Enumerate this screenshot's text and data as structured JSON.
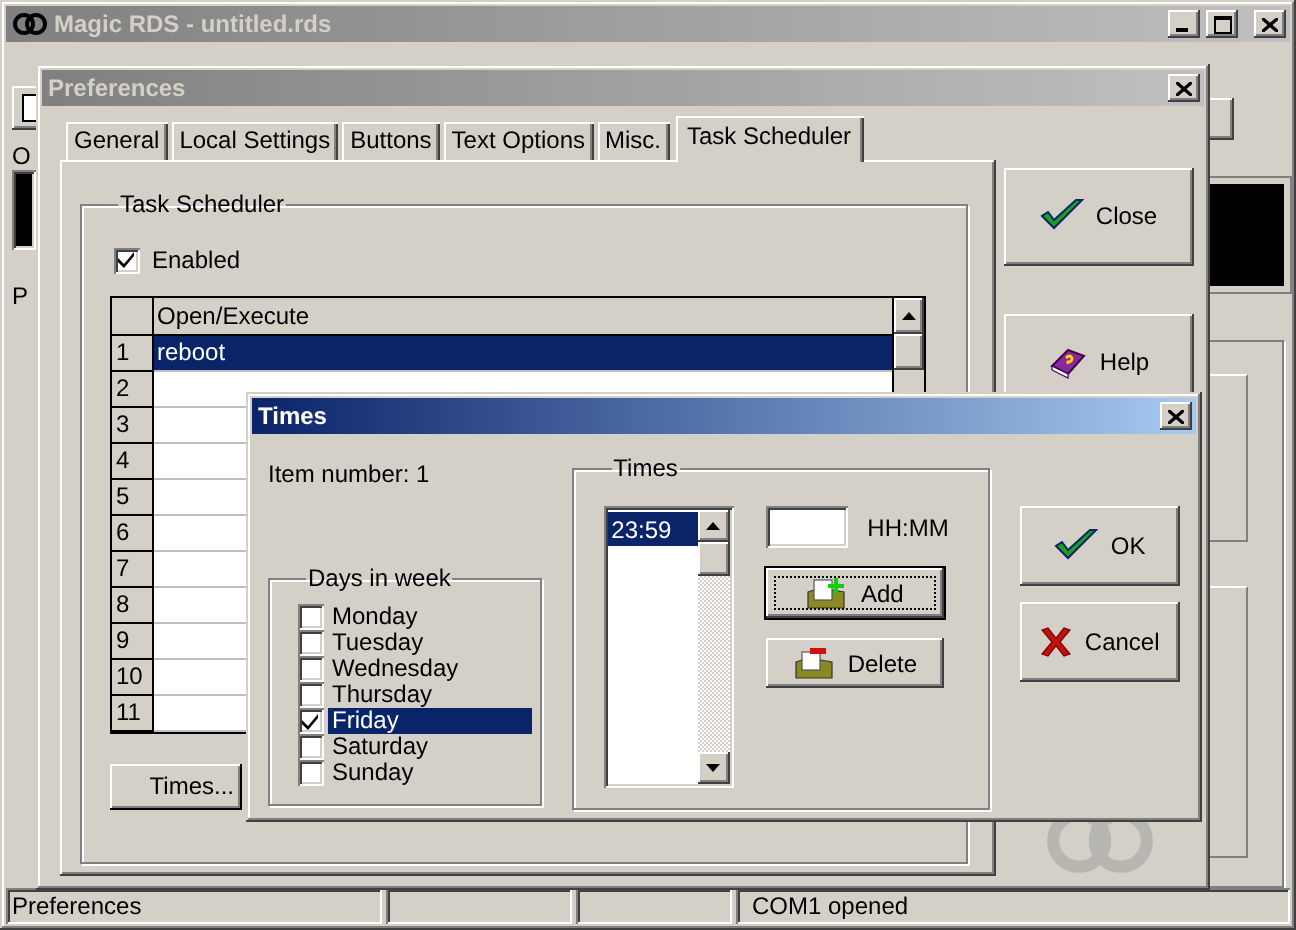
{
  "main_window": {
    "title": "Magic RDS - untitled.rds",
    "active": false,
    "group_labels": [
      "O",
      "P"
    ],
    "status_bar": [
      "Preferences",
      "COM1 opened"
    ]
  },
  "preferences": {
    "title": "Preferences",
    "active": false,
    "tabs": [
      {
        "label": "General",
        "selected": false
      },
      {
        "label": "Local Settings",
        "selected": false
      },
      {
        "label": "Buttons",
        "selected": false
      },
      {
        "label": "Text Options",
        "selected": false
      },
      {
        "label": "Misc.",
        "selected": false
      },
      {
        "label": "Task Scheduler",
        "selected": true
      }
    ],
    "group": "Task Scheduler",
    "enabled": {
      "label": "Enabled",
      "checked": true
    },
    "table": {
      "columns": [
        "Open/Execute"
      ],
      "rows": [
        {
          "number": "1",
          "value": "reboot",
          "selected": true
        },
        {
          "number": "2",
          "selected": false
        },
        {
          "number": "3",
          "selected": false
        },
        {
          "number": "4",
          "selected": false
        },
        {
          "number": "5",
          "selected": false
        },
        {
          "number": "6",
          "selected": false
        },
        {
          "number": "7",
          "selected": false
        },
        {
          "number": "8",
          "selected": false
        },
        {
          "number": "9",
          "selected": false
        },
        {
          "number": "10",
          "selected": false
        },
        {
          "number": "11",
          "selected": false
        }
      ]
    },
    "times_button": "Times...",
    "buttons": [
      {
        "kind": "close",
        "label": "Close"
      },
      {
        "kind": "help",
        "label": "Help"
      }
    ]
  },
  "times_dialog": {
    "title": "Times",
    "active": true,
    "item_number": "Item number: 1",
    "days_group": "Days in week",
    "days": [
      {
        "label": "Monday",
        "checked": false,
        "selected": false
      },
      {
        "label": "Tuesday",
        "checked": false,
        "selected": false
      },
      {
        "label": "Wednesday",
        "checked": false,
        "selected": false
      },
      {
        "label": "Thursday",
        "checked": false,
        "selected": false
      },
      {
        "label": "Friday",
        "checked": true,
        "selected": true
      },
      {
        "label": "Saturday",
        "checked": false,
        "selected": false
      },
      {
        "label": "Sunday",
        "checked": false,
        "selected": false
      }
    ],
    "times_group": "Times",
    "times_list": [
      {
        "value": "23:59",
        "selected": true
      }
    ],
    "time_format": "HH:MM",
    "actions": [
      {
        "kind": "add",
        "label": "Add"
      },
      {
        "kind": "delete",
        "label": "Delete"
      }
    ],
    "buttons": [
      {
        "kind": "ok",
        "label": "OK"
      },
      {
        "kind": "cancel",
        "label": "Cancel"
      }
    ]
  }
}
